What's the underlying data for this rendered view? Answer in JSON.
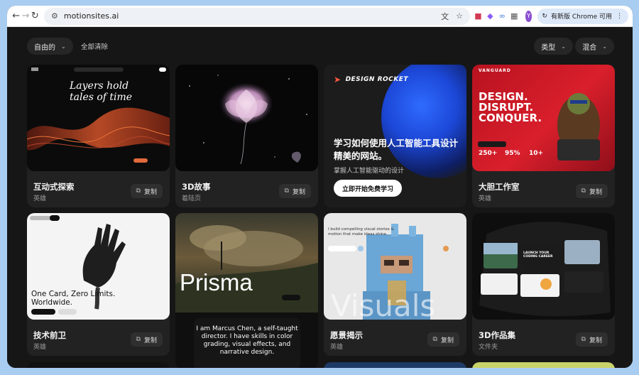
{
  "browser": {
    "url": "motionsites.ai",
    "avatar_letter": "Y",
    "update_label": "有新版 Chrome 可用"
  },
  "filters": {
    "left_filter": "自由的",
    "clear_all": "全部清除",
    "type_filter": "类型",
    "mix_filter": "混合"
  },
  "promo": {
    "brand": "DESIGN ROCKET",
    "headline": "学习如何使用人工智能工具设计精美的网站。",
    "subline": "掌握人工智能驱动的设计",
    "cta": "立即开始免费学习"
  },
  "copy_label": "复制",
  "cards": [
    {
      "title": "互动式探索",
      "subtitle": "英雄",
      "thumb_text": "Layers hold tales of time"
    },
    {
      "title": "3D故事",
      "subtitle": "着陆页",
      "thumb_text": ""
    },
    {
      "title": "大胆工作室",
      "subtitle": "英雄",
      "thumb_text": "DESIGN. DISRUPT. CONQUER.",
      "brand": "VANGUARD",
      "stats": [
        "250+",
        "95%",
        "10+"
      ]
    },
    {
      "title": "技术前卫",
      "subtitle": "英雄",
      "thumb_text": "One Card, Zero Limits. Worldwide."
    },
    {
      "title": "",
      "subtitle": "",
      "thumb_text": "Prisma",
      "extra_text": "I am Marcus Chen, a self-taught director. I have skills in color grading, visual effects, and narrative design."
    },
    {
      "title": "愿景揭示",
      "subtitle": "英雄",
      "thumb_text": "I build compelling visual stories & motion that make ideas shine."
    },
    {
      "title": "3D作品集",
      "subtitle": "文件夹",
      "thumb_text": "LAUNCH YOUR CODING CAREER"
    }
  ]
}
